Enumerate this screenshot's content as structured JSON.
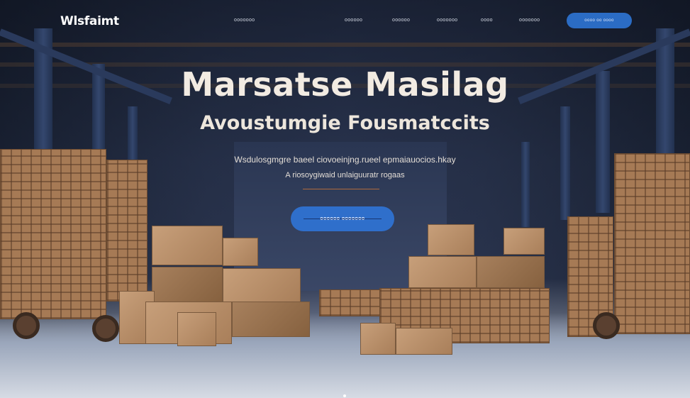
{
  "brand": {
    "logo_text": "Wlsfaimt"
  },
  "nav": {
    "links": [
      "ooooooo",
      "oooooo",
      "oooooo",
      "ooooooo",
      "oooo",
      "ooooooo"
    ],
    "cta_label": "oooo oo oooo"
  },
  "hero": {
    "title": "Marsatse Masilag",
    "subtitle": "Avoustumgie Fousmatccits",
    "description_line1": "Wsdulosgmgre baeel ciovoeinjng.rueel epmaiauocios.hkay",
    "description_line2": "A riosoygiwaid unlaiguuratr rogaas",
    "cta_label": "oooooo ooooooo"
  },
  "colors": {
    "accent": "#2f6fcb",
    "nav_cta": "#2b6cc4",
    "divider": "#b06a3c",
    "title_text": "#f2ebe2"
  }
}
